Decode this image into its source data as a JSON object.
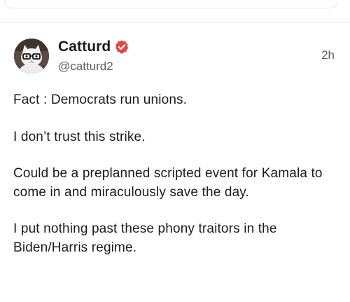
{
  "post": {
    "author_name": "Catturd",
    "handle": "@catturd2",
    "timestamp": "2h",
    "verified_color": "#e64545",
    "paragraphs": [
      "Fact : Democrats run unions.",
      "I don’t trust this strike.",
      "Could be a preplanned scripted event for Kamala to come in and miraculously save the day.",
      "I put nothing past these phony traitors in the Biden/Harris regime."
    ]
  },
  "icons": {
    "verified": "verified-badge-icon",
    "avatar": "cat-with-glasses-avatar"
  }
}
